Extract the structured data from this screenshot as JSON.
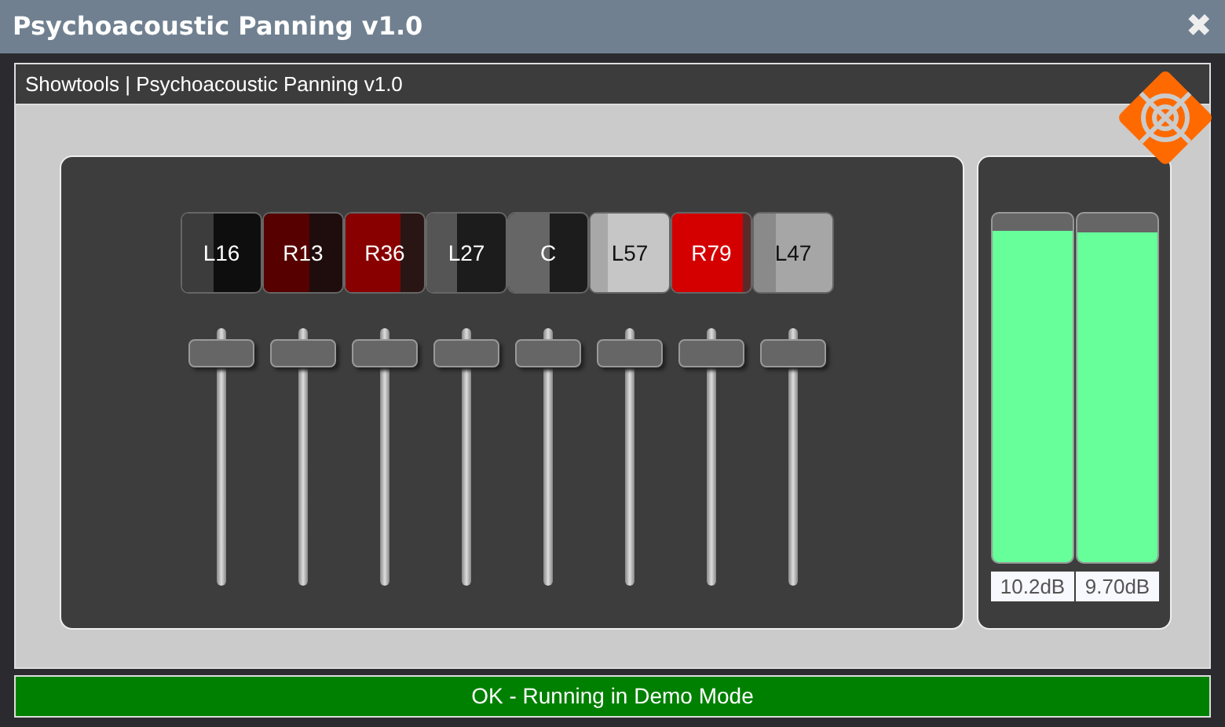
{
  "window": {
    "title": "Psychoacoustic Panning v1.0",
    "close": "✖"
  },
  "header": {
    "title": "Showtools | Psychoacoustic Panning v1.0"
  },
  "channels": [
    {
      "label": "L16",
      "color": "#0e0e0e",
      "pan": {
        "color": "#3c3c3c",
        "level": 0.4
      },
      "fader": {
        "level": 0.95
      }
    },
    {
      "label": "R13",
      "color": "#1f0d0d",
      "pan": {
        "color": "#560000",
        "level": 0.58
      },
      "fader": {
        "level": 0.95
      }
    },
    {
      "label": "R36",
      "color": "#2a1515",
      "pan": {
        "color": "#880000",
        "level": 0.69
      },
      "fader": {
        "level": 0.95
      }
    },
    {
      "label": "L27",
      "color": "#1c1c1c",
      "pan": {
        "color": "#555555",
        "level": 0.38
      },
      "fader": {
        "level": 0.95
      }
    },
    {
      "label": "C",
      "color": "#1c1c1c",
      "pan": {
        "color": "#666666",
        "level": 0.51
      },
      "fader": {
        "level": 0.95
      }
    },
    {
      "label": "L57",
      "color": "#c6c6c6",
      "pan": {
        "color": "#a8a8a8",
        "level": 0.21
      },
      "fader": {
        "level": 0.95
      }
    },
    {
      "label": "R79",
      "color": "#5a2a2a",
      "pan": {
        "color": "#d40000",
        "level": 0.9
      },
      "fader": {
        "level": 0.95
      }
    },
    {
      "label": "L47",
      "color": "#a6a6a6",
      "pan": {
        "color": "#8a8a8a",
        "level": 0.27
      },
      "fader": {
        "level": 0.95
      }
    }
  ],
  "meters": [
    {
      "level": 0.95,
      "reading": "10.2dB"
    },
    {
      "level": 0.945,
      "reading": "9.70dB"
    }
  ],
  "status_bar": {
    "text": "OK - Running in Demo Mode"
  }
}
